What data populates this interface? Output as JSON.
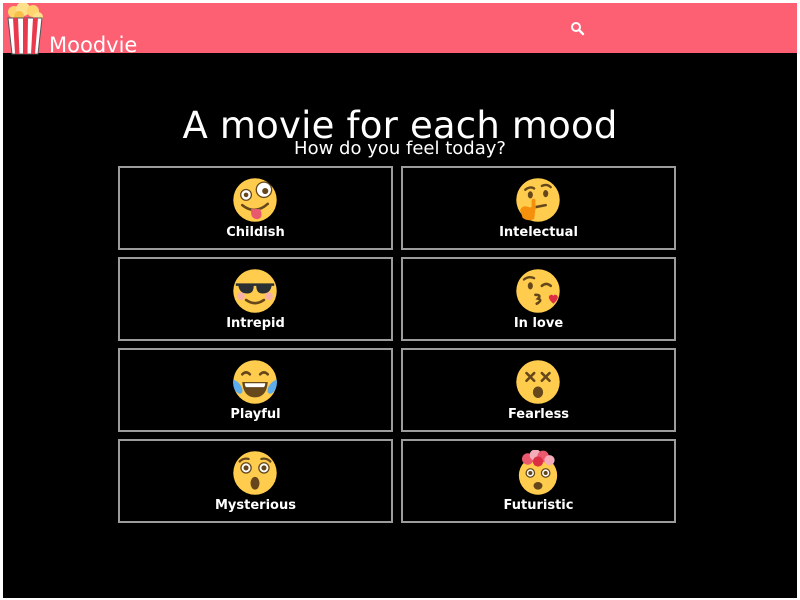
{
  "navbar": {
    "brand": "Moodvie",
    "logo_icon": "popcorn-icon",
    "search_icon": "search-icon",
    "color": "#fd5f73"
  },
  "hero": {
    "title": "A movie for each mood",
    "subtitle": "How do you feel today?"
  },
  "moods": [
    {
      "label": "Childish",
      "icon": "zany-face-icon"
    },
    {
      "label": "Intelectual",
      "icon": "thinking-face-icon"
    },
    {
      "label": "Intrepid",
      "icon": "sunglasses-face-icon"
    },
    {
      "label": "In love",
      "icon": "kissing-face-icon"
    },
    {
      "label": "Playful",
      "icon": "tears-of-joy-face-icon"
    },
    {
      "label": "Fearless",
      "icon": "dizzy-face-icon"
    },
    {
      "label": "Mysterious",
      "icon": "astonished-face-icon"
    },
    {
      "label": "Futuristic",
      "icon": "exploding-head-icon"
    }
  ],
  "colors": {
    "background": "#000000",
    "card_border": "#9c9c9c",
    "emoji_yellow": "#ffcc4d"
  }
}
